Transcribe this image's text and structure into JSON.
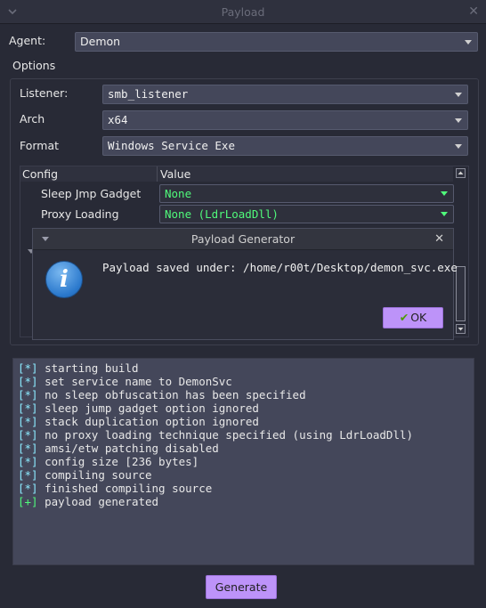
{
  "window": {
    "title": "Payload"
  },
  "agent": {
    "label": "Agent:",
    "value": "Demon"
  },
  "options": {
    "label": "Options",
    "listener": {
      "label": "Listener:",
      "value": "smb_listener"
    },
    "arch": {
      "label": "Arch",
      "value": "x64"
    },
    "format": {
      "label": "Format",
      "value": "Windows Service Exe"
    },
    "table": {
      "col_config": "Config",
      "col_value": "Value",
      "rows": [
        {
          "key": "Sleep Jmp Gadget",
          "value": "None"
        },
        {
          "key": "Proxy Loading",
          "value": "None (LdrLoadDll)"
        }
      ]
    }
  },
  "dialog": {
    "title": "Payload Generator",
    "message": "Payload saved under: /home/r00t/Desktop/demon_svc.exe",
    "ok_label": "OK",
    "icon": "info-icon"
  },
  "console": {
    "lines": [
      {
        "tag": "[*]",
        "text": "starting build"
      },
      {
        "tag": "[*]",
        "text": "set service name to DemonSvc"
      },
      {
        "tag": "[*]",
        "text": "no sleep obfuscation has been specified"
      },
      {
        "tag": "[*]",
        "text": "sleep jump gadget option ignored"
      },
      {
        "tag": "[*]",
        "text": "stack duplication option ignored"
      },
      {
        "tag": "[*]",
        "text": "no proxy loading technique specified (using LdrLoadDll)"
      },
      {
        "tag": "[*]",
        "text": "amsi/etw patching disabled"
      },
      {
        "tag": "[*]",
        "text": "config size [236 bytes]"
      },
      {
        "tag": "[*]",
        "text": "compiling source"
      },
      {
        "tag": "[*]",
        "text": "finished compiling source"
      },
      {
        "tag": "[+]",
        "text": "payload generated"
      }
    ]
  },
  "generate": {
    "label": "Generate"
  },
  "colors": {
    "background": "#282a36",
    "field": "#44475a",
    "accent": "#bd93f9",
    "green": "#50fa7b",
    "cyan": "#8be9fd"
  }
}
